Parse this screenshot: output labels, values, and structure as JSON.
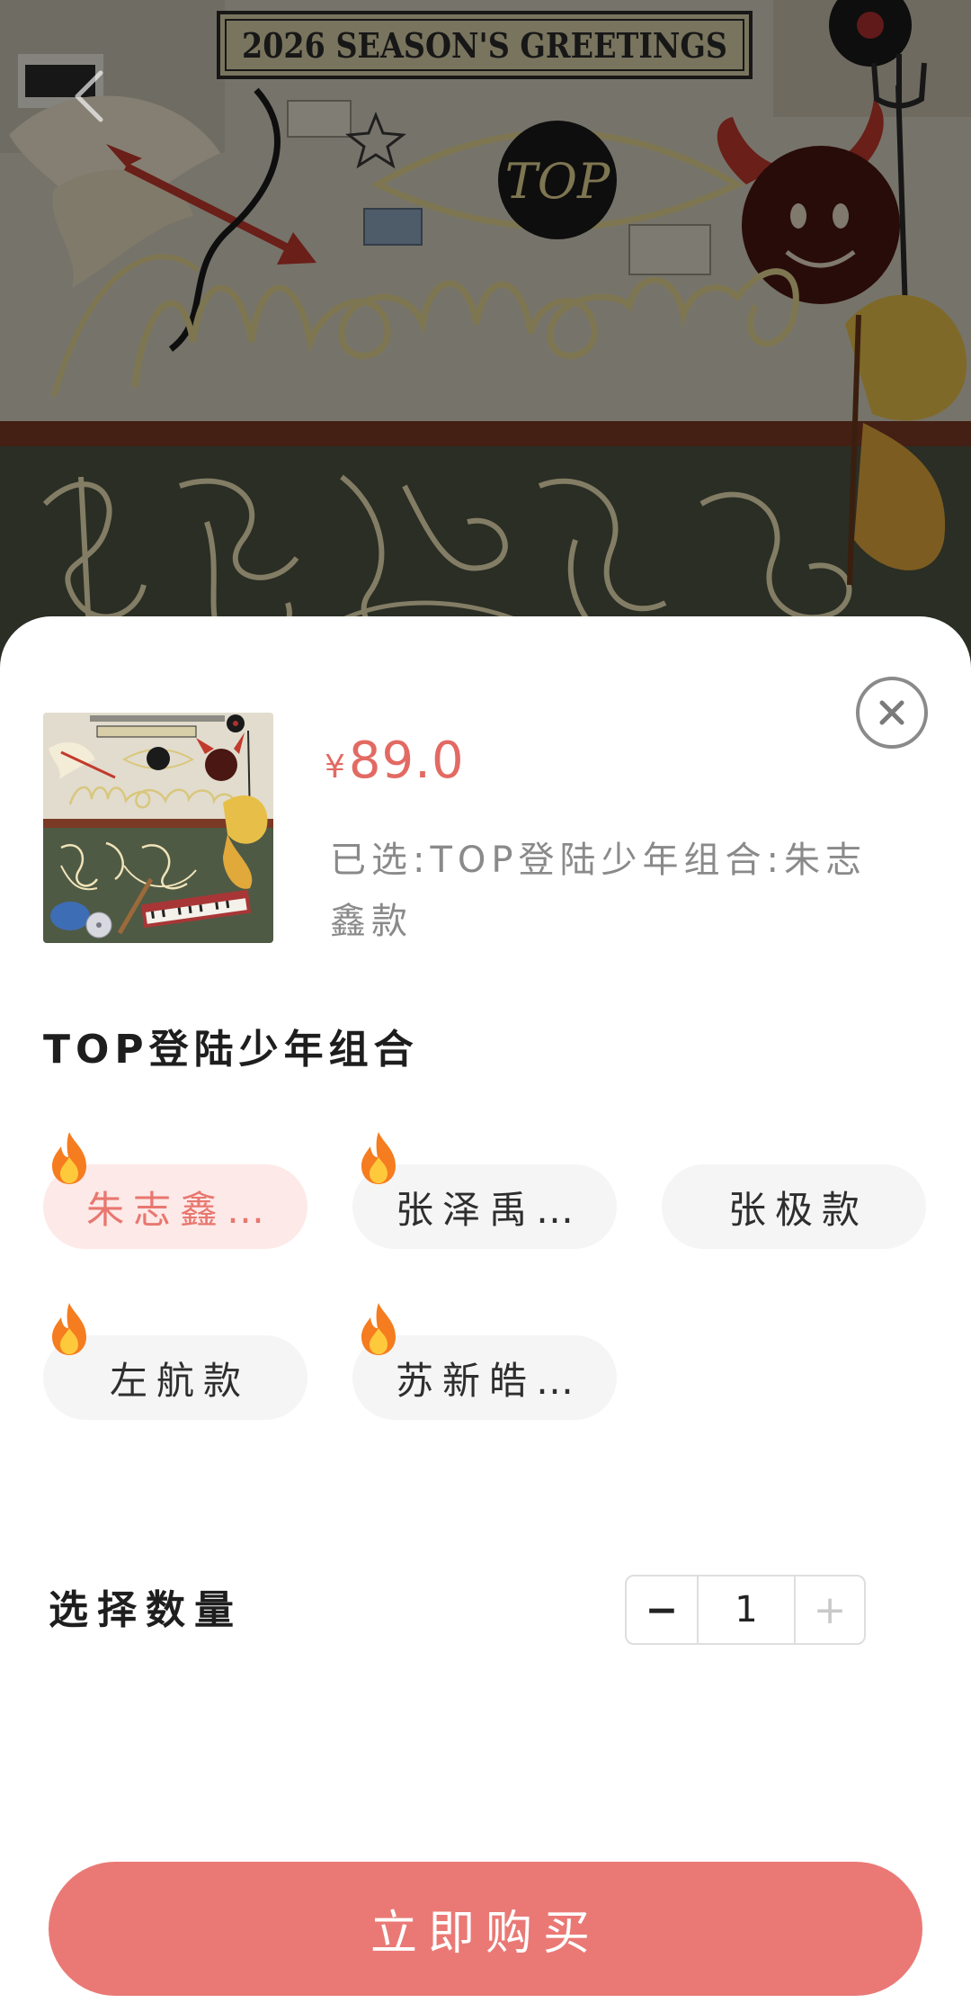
{
  "hero_image": {
    "banner_text": "2026 SEASON'S GREETINGS",
    "badge_text": "TOP"
  },
  "nav": {
    "back_icon": "chevron-left-icon"
  },
  "sheet": {
    "price": {
      "currency": "¥",
      "amount": "89.0"
    },
    "selected_summary": "已选:TOP登陆少年组合:朱志鑫款",
    "close_icon": "close-icon",
    "option_group": {
      "title": "TOP登陆少年组合",
      "options": [
        {
          "label": "朱志鑫…",
          "selected": true,
          "badge_icon": "fire-icon"
        },
        {
          "label": "张泽禹…",
          "selected": false,
          "badge_icon": "fire-icon"
        },
        {
          "label": "张极款",
          "selected": false,
          "badge_icon": null
        },
        {
          "label": "左航款",
          "selected": false,
          "badge_icon": "fire-icon"
        },
        {
          "label": "苏新皓…",
          "selected": false,
          "badge_icon": "fire-icon"
        }
      ]
    },
    "quantity": {
      "label": "选择数量",
      "decrement_label": "−",
      "value": "1",
      "increment_label": "+",
      "increment_disabled": true
    },
    "buy_button_label": "立即购买"
  },
  "colors": {
    "accent": "#ea7975",
    "price": "#e26a63",
    "chip_selected_bg": "#fde9e8",
    "chip_selected_text": "#e8776f",
    "muted_text": "#8a8a8a"
  }
}
